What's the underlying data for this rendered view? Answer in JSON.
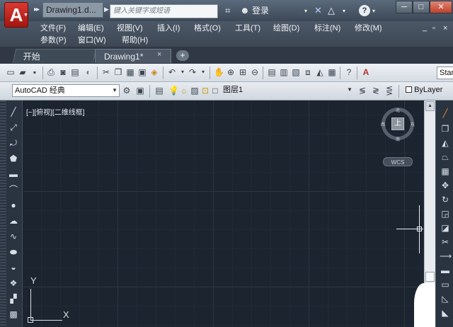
{
  "titlebar": {
    "logo": "A",
    "doc_title": "Drawing1.d...",
    "search_placeholder": "键入关键字或短语",
    "login": "登录",
    "help": "?"
  },
  "menu": {
    "row1": [
      "文件(F)",
      "编辑(E)",
      "视图(V)",
      "插入(I)",
      "格式(O)",
      "工具(T)",
      "绘图(D)",
      "标注(N)",
      "修改(M)"
    ],
    "row2": [
      "参数(P)",
      "窗口(W)",
      "帮助(H)"
    ],
    "controls": [
      "_",
      "▫",
      "×"
    ]
  },
  "tabs": {
    "start": "开始",
    "active": "Drawing1*",
    "close": "×",
    "add": "+"
  },
  "toolbar": {
    "workspace": "AutoCAD 经典",
    "layer": "图层1",
    "linetype": "ByLayer",
    "style_box": "Stan"
  },
  "canvas": {
    "viewport_label": "[−][俯视][二维线框]",
    "viewcube_face": "上",
    "compass": [
      "北",
      "东",
      "南",
      "西"
    ],
    "wcs": "WCS",
    "axis_x": "X",
    "axis_y": "Y"
  },
  "icons": {
    "left": [
      "line-icon",
      "construction-line-icon",
      "polyline-icon",
      "polygon-icon",
      "rectangle-icon",
      "arc-icon",
      "circle-icon",
      "revision-cloud-icon",
      "spline-icon",
      "ellipse-icon",
      "ellipse-arc-icon",
      "insert-block-icon",
      "make-block-icon",
      "point-icon",
      "hatch-icon"
    ],
    "right": [
      "erase-icon",
      "copy-icon",
      "mirror-icon",
      "offset-icon",
      "array-icon",
      "move-icon",
      "rotate-icon",
      "scale-icon",
      "stretch-icon",
      "trim-icon",
      "extend-icon",
      "break-icon",
      "join-icon",
      "chamfer-icon",
      "fillet-icon"
    ]
  },
  "colors": {
    "canvas": "#1c2430",
    "accent_red": "#c02a22"
  }
}
